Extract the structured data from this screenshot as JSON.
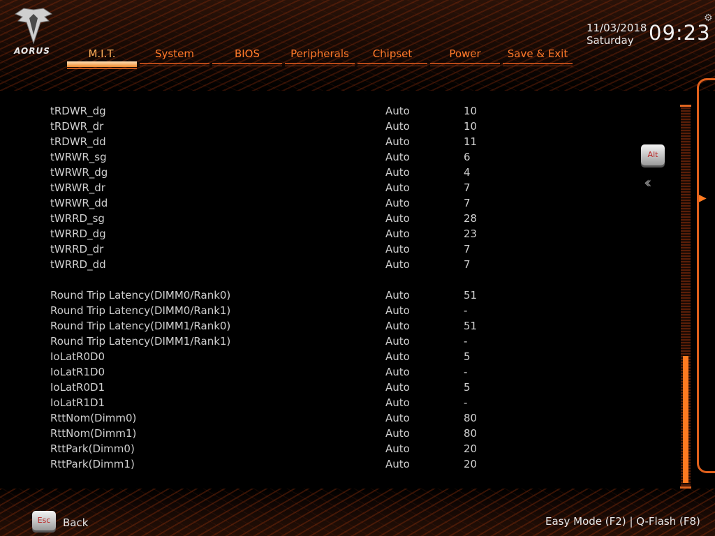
{
  "brand": {
    "logo_text": "AORUS",
    "accent_color": "#ff7a2a"
  },
  "tabs": [
    {
      "label": "M.I.T.",
      "active": true
    },
    {
      "label": "System"
    },
    {
      "label": "BIOS"
    },
    {
      "label": "Peripherals"
    },
    {
      "label": "Chipset"
    },
    {
      "label": "Power"
    },
    {
      "label": "Save & Exit"
    }
  ],
  "datetime": {
    "date": "11/03/2018",
    "day": "Saturday",
    "time": "09:23"
  },
  "settings": [
    {
      "name": "tRDWR_dg",
      "option": "Auto",
      "value": "10"
    },
    {
      "name": "tRDWR_dr",
      "option": "Auto",
      "value": "10"
    },
    {
      "name": "tRDWR_dd",
      "option": "Auto",
      "value": "11"
    },
    {
      "name": "tWRWR_sg",
      "option": "Auto",
      "value": "6"
    },
    {
      "name": "tWRWR_dg",
      "option": "Auto",
      "value": "4"
    },
    {
      "name": "tWRWR_dr",
      "option": "Auto",
      "value": "7"
    },
    {
      "name": "tWRWR_dd",
      "option": "Auto",
      "value": "7"
    },
    {
      "name": "tWRRD_sg",
      "option": "Auto",
      "value": "28"
    },
    {
      "name": "tWRRD_dg",
      "option": "Auto",
      "value": "23"
    },
    {
      "name": "tWRRD_dr",
      "option": "Auto",
      "value": "7"
    },
    {
      "name": "tWRRD_dd",
      "option": "Auto",
      "value": "7"
    },
    {
      "spacer": true
    },
    {
      "name": "Round Trip Latency(DIMM0/Rank0)",
      "option": "Auto",
      "value": "51"
    },
    {
      "name": "Round Trip Latency(DIMM0/Rank1)",
      "option": "Auto",
      "value": "-"
    },
    {
      "name": "Round Trip Latency(DIMM1/Rank0)",
      "option": "Auto",
      "value": "51"
    },
    {
      "name": "Round Trip Latency(DIMM1/Rank1)",
      "option": "Auto",
      "value": "-"
    },
    {
      "name": "IoLatR0D0",
      "option": "Auto",
      "value": "5"
    },
    {
      "name": "IoLatR1D0",
      "option": "Auto",
      "value": "-"
    },
    {
      "name": "IoLatR0D1",
      "option": "Auto",
      "value": "5"
    },
    {
      "name": "IoLatR1D1",
      "option": "Auto",
      "value": "-"
    },
    {
      "name": "RttNom(Dimm0)",
      "option": "Auto",
      "value": "80"
    },
    {
      "name": "RttNom(Dimm1)",
      "option": "Auto",
      "value": "80"
    },
    {
      "name": "RttPark(Dimm0)",
      "option": "Auto",
      "value": "20"
    },
    {
      "name": "RttPark(Dimm1)",
      "option": "Auto",
      "value": "20"
    }
  ],
  "keys": {
    "alt": "Alt",
    "esc": "Esc"
  },
  "footer": {
    "back_label": "Back",
    "easy_mode": "Easy Mode (F2)",
    "separator": "|",
    "qflash": "Q-Flash (F8)"
  }
}
